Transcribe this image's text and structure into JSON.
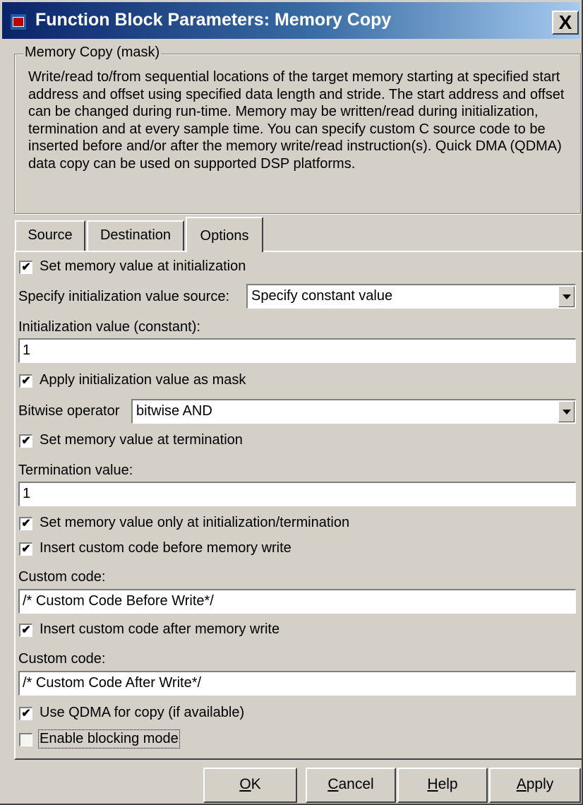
{
  "window": {
    "title": "Function Block Parameters: Memory Copy",
    "close_label": "X"
  },
  "mask": {
    "legend": "Memory Copy (mask)",
    "description": "Write/read to/from sequential locations of the target memory starting at specified start address and offset using specified data length and stride. The start address and offset can be changed during run-time. Memory may be written/read during initialization, termination and at every sample time. You can specify custom C source code to be inserted before and/or after the memory write/read instruction(s). Quick DMA (QDMA) data copy can be used on supported DSP platforms."
  },
  "tabs": {
    "source": "Source",
    "destination": "Destination",
    "options": "Options",
    "active": "Options"
  },
  "options": {
    "set_init": {
      "label": "Set memory value at initialization",
      "checked": true
    },
    "init_source": {
      "label": "Specify initialization value source:",
      "value": "Specify constant value"
    },
    "init_value": {
      "label": "Initialization value (constant):",
      "value": "1"
    },
    "apply_mask": {
      "label": "Apply initialization value as mask",
      "checked": true
    },
    "bitwise": {
      "label": "Bitwise operator",
      "value": "bitwise AND"
    },
    "set_term": {
      "label": "Set memory value at termination",
      "checked": true
    },
    "term_value": {
      "label": "Termination value:",
      "value": "1"
    },
    "only_init_term": {
      "label": "Set memory value only at initialization/termination",
      "checked": true
    },
    "code_before": {
      "label": "Insert custom code before memory write",
      "checked": true
    },
    "custom_before": {
      "label": "Custom code:",
      "value": "/* Custom Code Before Write*/"
    },
    "code_after": {
      "label": "Insert custom code after memory write",
      "checked": true
    },
    "custom_after": {
      "label": "Custom code:",
      "value": "/* Custom Code After Write*/"
    },
    "use_qdma": {
      "label": "Use QDMA for copy (if available)",
      "checked": true
    },
    "blocking": {
      "label": "Enable blocking mode",
      "checked": false
    }
  },
  "checkmark_glyph": "✔",
  "buttons": {
    "ok": {
      "mnemonic": "O",
      "rest": "K"
    },
    "cancel": {
      "mnemonic": "C",
      "rest": "ancel"
    },
    "help": {
      "mnemonic": "H",
      "rest": "elp"
    },
    "apply": {
      "mnemonic": "A",
      "rest": "pply"
    }
  },
  "icons": {
    "app": "simulink-block-icon",
    "close": "close-icon",
    "dropdown": "chevron-down-icon",
    "check": "checkmark-icon"
  },
  "colors": {
    "dialog_bg": "#d4d0c8",
    "title_start": "#0a246a",
    "title_end": "#a6caf0"
  }
}
